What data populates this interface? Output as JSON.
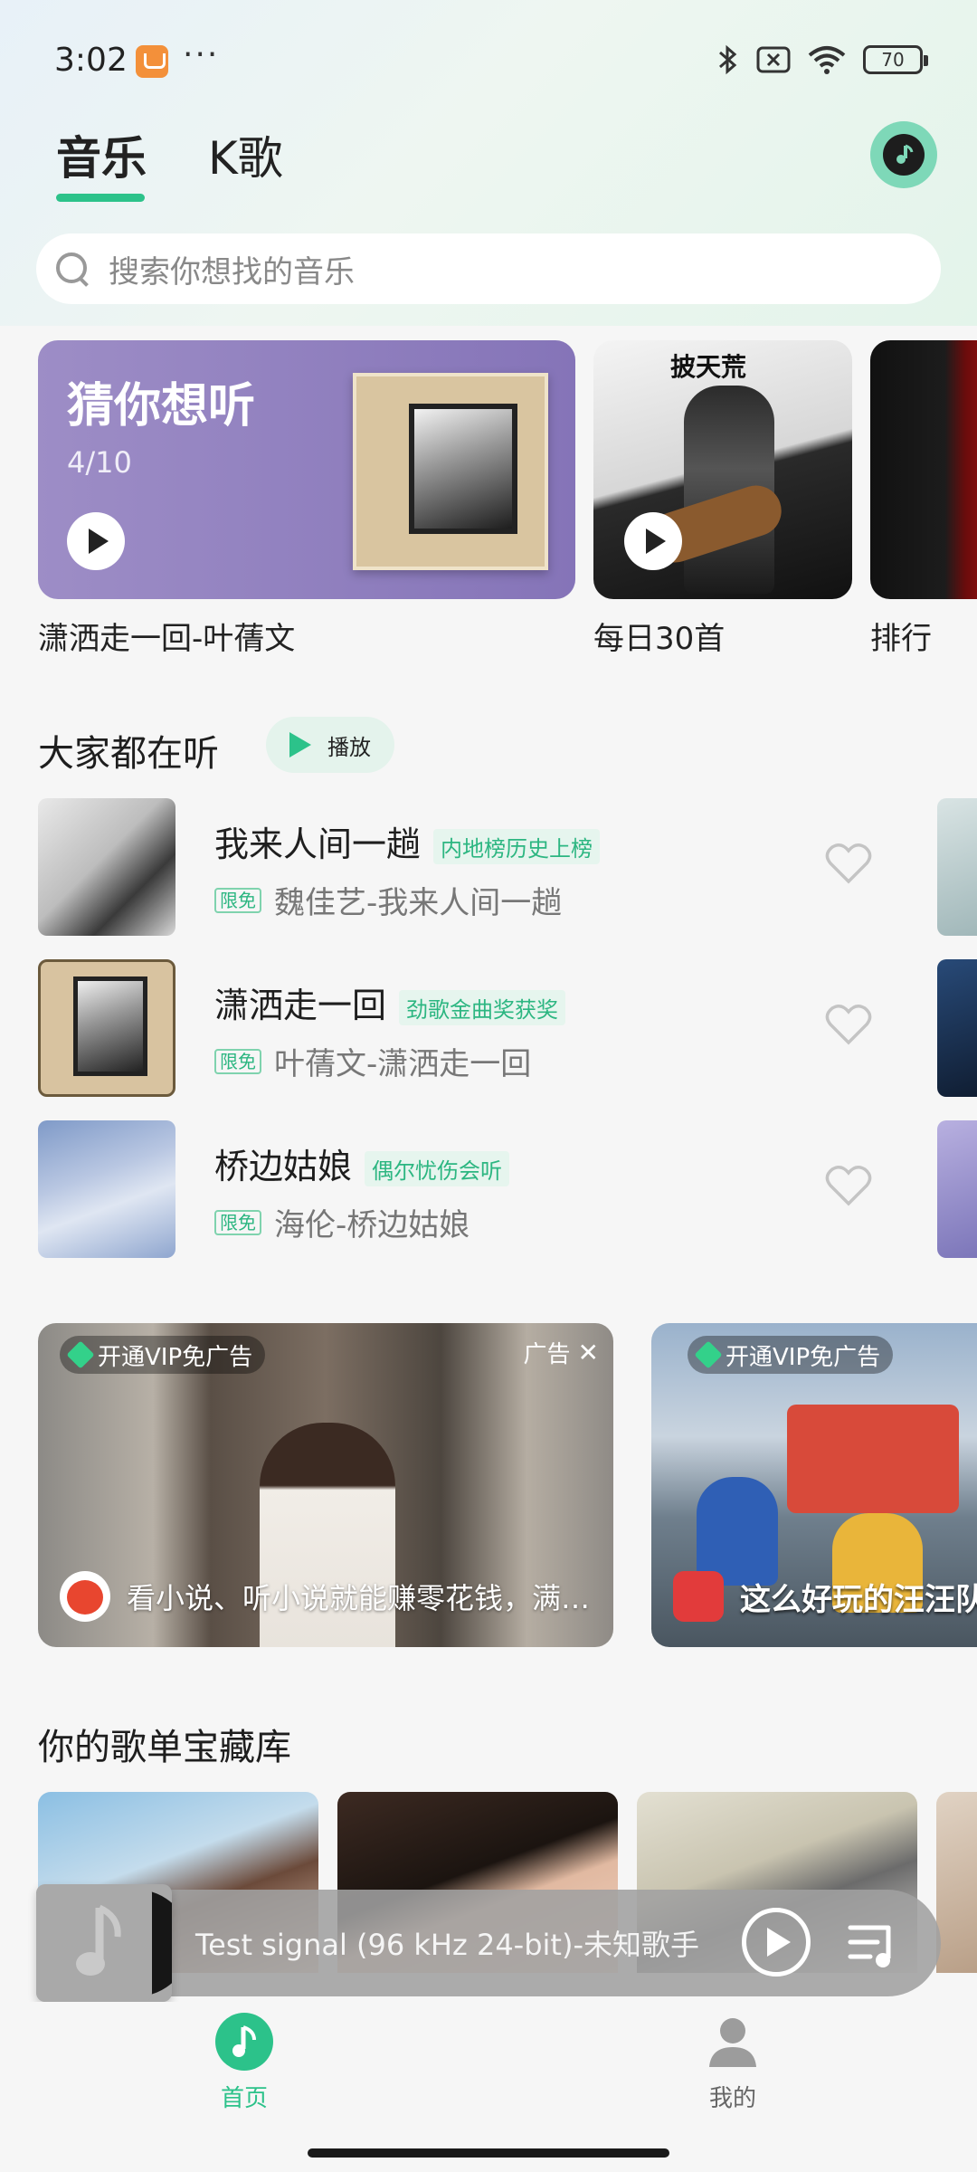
{
  "status_bar": {
    "time": "3:02",
    "dots": "···",
    "battery": "70"
  },
  "tabs": [
    {
      "label": "音乐",
      "active": true
    },
    {
      "label": "K歌",
      "active": false
    }
  ],
  "search": {
    "placeholder": "搜索你想找的音乐"
  },
  "top_cards": {
    "guess": {
      "title": "猜你想听",
      "count": "4/10",
      "caption": "潇洒走一回-叶蒨文"
    },
    "daily": {
      "cover_title": "披天荒",
      "caption": "每日30首"
    },
    "rank": {
      "caption": "排行"
    }
  },
  "everyone_listening": {
    "title": "大家都在听",
    "play_label": "播放",
    "songs": [
      {
        "title": "我来人间一趟",
        "tag": "内地榜历史上榜",
        "badge": "限免",
        "artist": "魏佳艺-我来人间一趟"
      },
      {
        "title": "潇洒走一回",
        "tag": "劲歌金曲奖获奖",
        "badge": "限免",
        "artist": "叶蒨文-潇洒走一回"
      },
      {
        "title": "桥边姑娘",
        "tag": "偶尔忧伤会听",
        "badge": "限免",
        "artist": "海伦-桥边姑娘"
      }
    ]
  },
  "ads": [
    {
      "vip_label": "开通VIP免广告",
      "ad_label": "广告",
      "caption": "看小说、听小说就能赚零花钱，满1..."
    },
    {
      "vip_label": "开通VIP免广告",
      "caption": "这么好玩的汪汪队"
    }
  ],
  "playlist_section": {
    "title": "你的歌单宝藏库"
  },
  "mini_player": {
    "title": "Test signal (96 kHz 24-bit)-未知歌手"
  },
  "bottom_nav": [
    {
      "label": "首页",
      "active": true
    },
    {
      "label": "我的",
      "active": false
    }
  ],
  "colors": {
    "accent": "#2cc28a",
    "guess_card": "#8c7bbd"
  }
}
